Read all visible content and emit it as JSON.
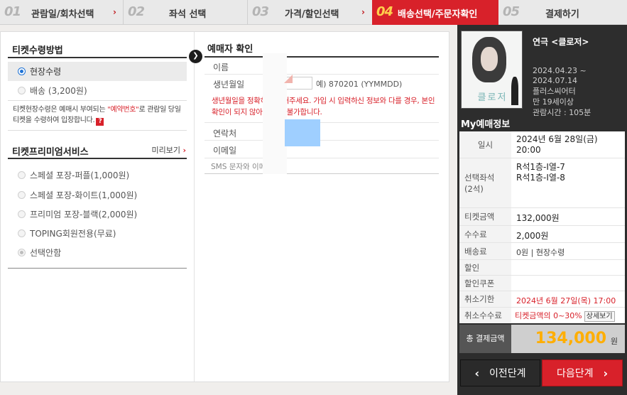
{
  "steps": [
    {
      "num": "01",
      "label": "관람일/회차선택",
      "active": false
    },
    {
      "num": "02",
      "label": "좌석 선택",
      "active": false
    },
    {
      "num": "03",
      "label": "가격/할인선택",
      "active": false
    },
    {
      "num": "04",
      "label": "배송선택/주문자확인",
      "active": true
    },
    {
      "num": "05",
      "label": "결제하기",
      "active": false
    }
  ],
  "step_arrow": "›",
  "ticket_method": {
    "title": "티켓수령방법",
    "options": [
      "현장수령",
      "배송 (3,200원)"
    ],
    "note_prefix": "티켓현장수령은 예매시 부여되는 ",
    "note_highlight": "\"예약번호\"",
    "note_suffix": "로 관람일 당일 티켓을 수령하여 입장합니다.",
    "help": "?"
  },
  "premium": {
    "title": "티켓프리미엄서비스",
    "preview": "미리보기",
    "preview_arrow": "›",
    "options": [
      "스페셜 포장-퍼플(1,000원)",
      "스페셜 포장-화이트(1,000원)",
      "프리미엄 포장-블랙(2,000원)",
      "TOPING회원전용(무료)",
      "선택안함"
    ]
  },
  "booker": {
    "bullet": "❯",
    "title": "예매자 확인",
    "name_label": "이름",
    "birth_label": "생년월일",
    "birth_hint": "예) 870201 (YYMMDD)",
    "warning": "생년월일을 정확히 입력해주세요. 가입 시 입력하신 정보와 다를 경우, 본인확인이 되지 않아 예매가 불가합니다.",
    "contact_label": "연락처",
    "email_label": "이메일",
    "sms_label": "SMS 문자와 이메"
  },
  "show": {
    "title": "연극 <클로저>",
    "period": "2024.04.23 ~\n2024.07.14",
    "venue": "플러스씨어터",
    "age": "만 19세이상",
    "runtime": "관람시간 : 105분",
    "poster_text": "클로저"
  },
  "my_booking": {
    "title": "My예매정보",
    "date_label": "일시",
    "date_value": "2024년 6월 28일(금)\n20:00",
    "seat_label": "선택좌석\n(2석)",
    "seat_value": "R석1층-I열-7\nR석1층-I열-8",
    "ticket_label": "티켓금액",
    "ticket_value": "132,000원",
    "fee_label": "수수료",
    "fee_value": "2,000원",
    "delivery_label": "배송료",
    "delivery_value": "0원 | 현장수령",
    "discount_label": "할인",
    "coupon_label": "할인쿠폰",
    "cancel_deadline_label": "취소기한",
    "cancel_deadline_value": "2024년 6월 27일(목) 17:00",
    "cancel_fee_label": "취소수수료",
    "cancel_fee_value": "티켓금액의 0~30%",
    "cancel_fee_button": "상세보기"
  },
  "total": {
    "label": "총 결제금액",
    "value": "134,000",
    "unit": "원"
  },
  "buttons": {
    "prev": "이전단계",
    "prev_icon": "‹",
    "next": "다음단계",
    "next_icon": "›"
  },
  "colors": {
    "accent": "#d8212a",
    "total_amount": "#ffae00",
    "highlight_step_num": "#ffcf4c"
  }
}
